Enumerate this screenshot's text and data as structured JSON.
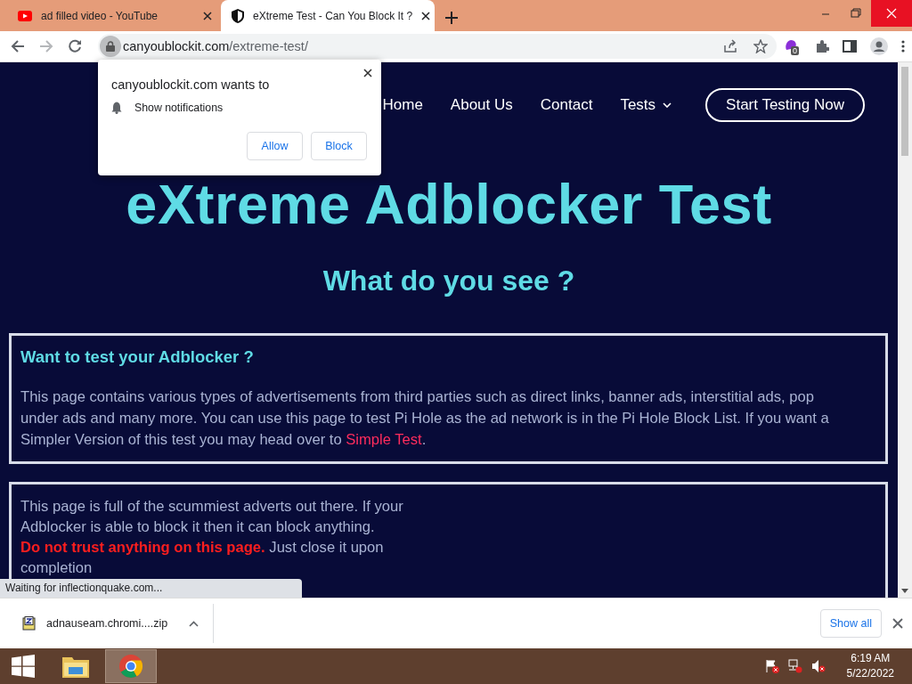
{
  "tabs": [
    {
      "title": "ad filled video - YouTube",
      "kind": "video",
      "selected": false
    },
    {
      "title": "eXtreme Test - Can You Block It ?",
      "kind": "site",
      "selected": true
    }
  ],
  "nav_buttons": [
    {
      "kind": "back",
      "disabled": false
    },
    {
      "kind": "forward",
      "disabled": true
    },
    {
      "kind": "reload",
      "disabled": false
    }
  ],
  "address": {
    "host": "canyoublockit.com",
    "path": "/extreme-test/"
  },
  "extension_badge": "0",
  "permission_prompt": {
    "title": "canyoublockit.com wants to",
    "permission": "Show notifications",
    "buttons": [
      "Allow",
      "Block"
    ]
  },
  "site_nav": {
    "links": [
      {
        "label": "Home",
        "dropdown": false
      },
      {
        "label": "About Us",
        "dropdown": false
      },
      {
        "label": "Contact",
        "dropdown": false
      },
      {
        "label": "Tests",
        "dropdown": true
      }
    ],
    "cta": "Start Testing Now"
  },
  "hero": {
    "title": "eXtreme Adblocker Test",
    "subtitle": "What do you see ?"
  },
  "sections": [
    {
      "heading": "Want to test your Adblocker ?",
      "text": "This page contains various types of advertisements from third parties such as direct links, banner ads, interstitial ads, pop under ads and many more. You can use this page to test Pi Hole as the ad network is in the Pi Hole Block List. If you want a Simpler Version of this test you may head over to ",
      "link": "Simple Test",
      "text_after": "."
    },
    {
      "text": "This page is full of the scummiest adverts out there. If your Adblocker is able to block it then it can block anything. **Do not trust anything on this page.** Just close it upon completion"
    }
  ],
  "status_text": "Waiting for inflectionquake.com...",
  "download": {
    "file": "adnauseam.chromi....zip",
    "show_all": "Show all"
  },
  "taskbar": {
    "apps": [
      {
        "kind": "explorer",
        "selected": false
      },
      {
        "kind": "chrome",
        "selected": true
      }
    ],
    "time": "6:19 AM",
    "date": "5/22/2022"
  }
}
